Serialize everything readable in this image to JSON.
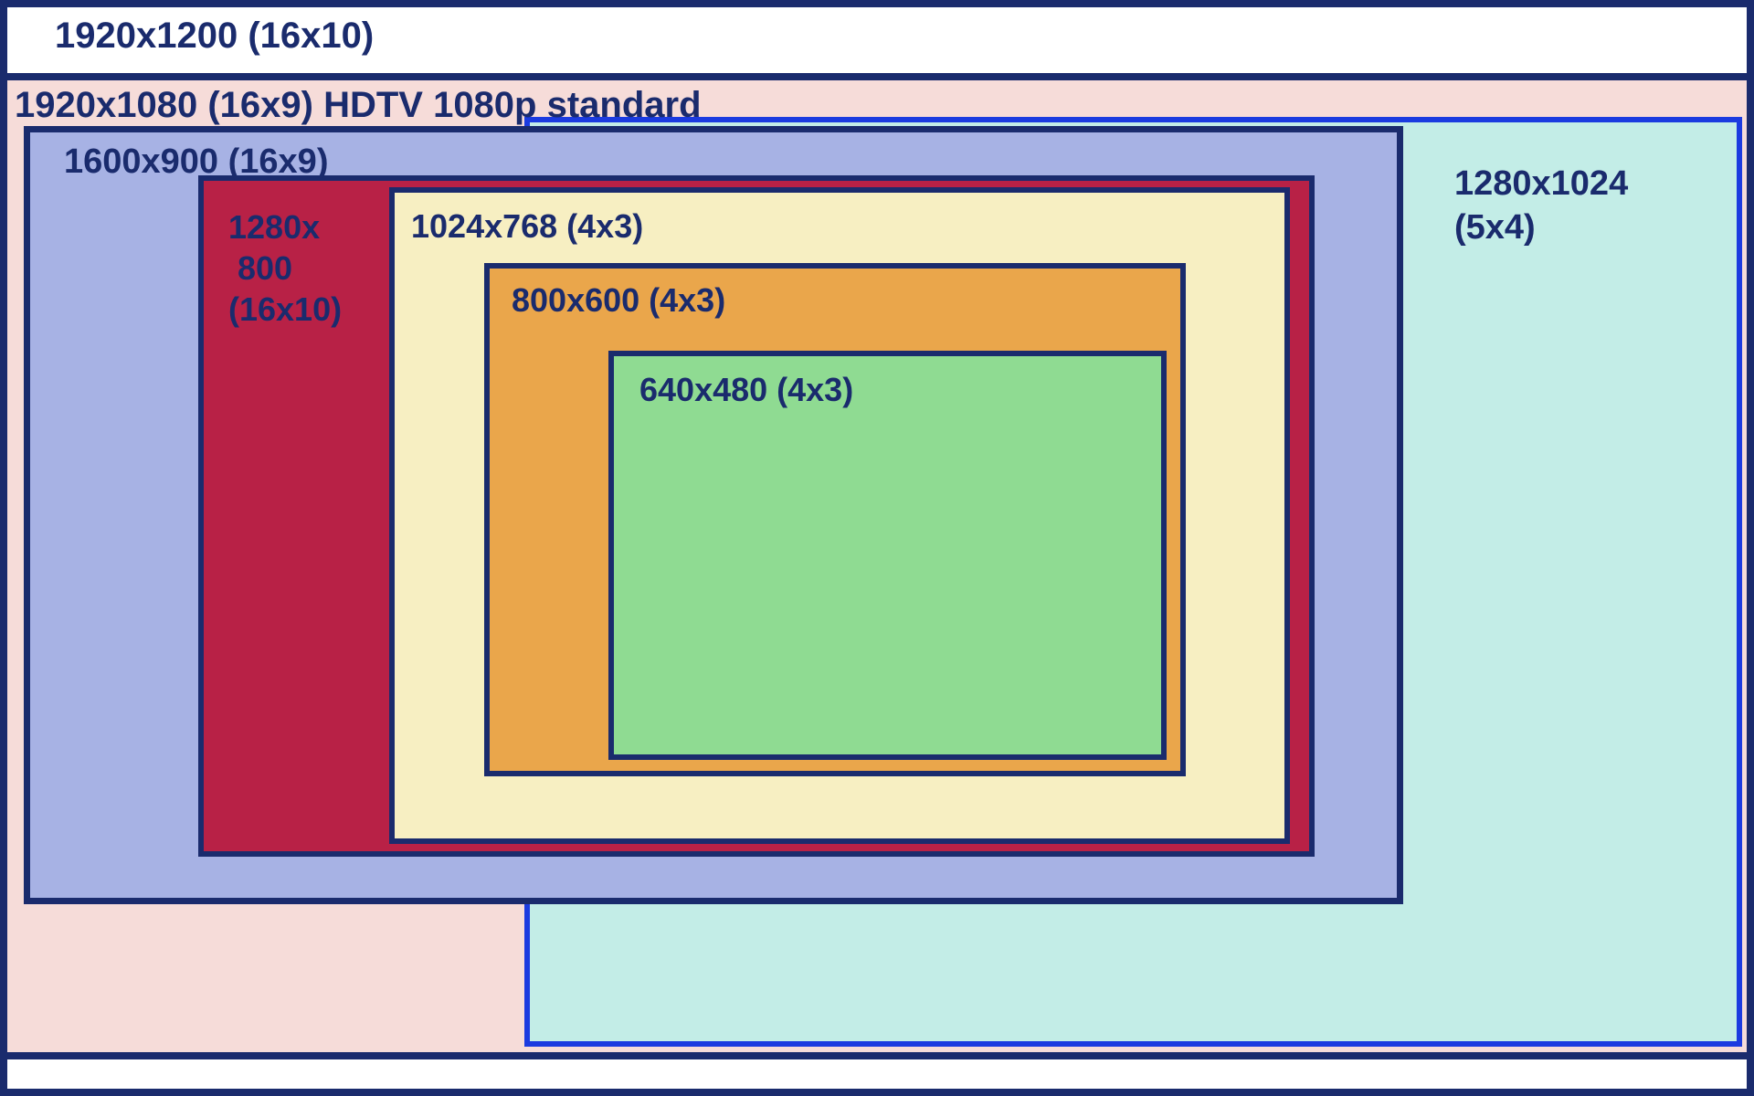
{
  "chart_data": {
    "type": "area",
    "title": "",
    "series": [
      {
        "name": "1920x1200 (16x10)",
        "values": [
          1920,
          1200
        ],
        "aspect": "16x10",
        "color": "#ffffff"
      },
      {
        "name": "1920x1080 (16x9) HDTV 1080p standard",
        "values": [
          1920,
          1080
        ],
        "aspect": "16x9",
        "color": "#f6dcd9"
      },
      {
        "name": "1600x900 (16x9)",
        "values": [
          1600,
          900
        ],
        "aspect": "16x9",
        "color": "#a7b2e4"
      },
      {
        "name": "1280x1024 (5x4)",
        "values": [
          1280,
          1024
        ],
        "aspect": "5x4",
        "color": "#c3ede7"
      },
      {
        "name": "1280x800 (16x10)",
        "values": [
          1280,
          800
        ],
        "aspect": "16x10",
        "color": "#b82146"
      },
      {
        "name": "1024x768 (4x3)",
        "values": [
          1024,
          768
        ],
        "aspect": "4x3",
        "color": "#f7efc2"
      },
      {
        "name": "800x600 (4x3)",
        "values": [
          800,
          600
        ],
        "aspect": "4x3",
        "color": "#eaa64b"
      },
      {
        "name": "640x480 (4x3)",
        "values": [
          640,
          480
        ],
        "aspect": "4x3",
        "color": "#8fdb92"
      }
    ]
  },
  "labels": {
    "r1920x1200": "1920x1200 (16x10)",
    "r1920x1080": "1920x1080 (16x9) HDTV 1080p standard",
    "r1600x900": "1600x900 (16x9)",
    "r1280x1024": "1280x1024\n(5x4)",
    "r1280x800": "1280x\n 800\n(16x10)",
    "r1024x768": "1024x768 (4x3)",
    "r800x600": "800x600 (4x3)",
    "r640x480": "640x480 (4x3)"
  }
}
